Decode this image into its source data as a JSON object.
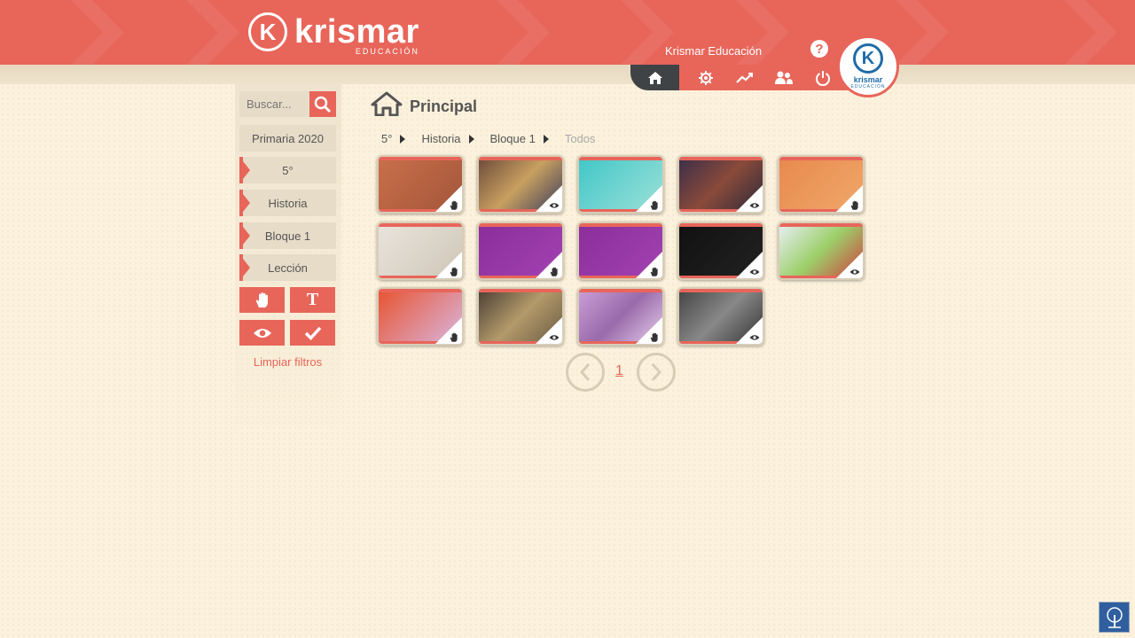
{
  "header": {
    "brand_word": "krismar",
    "brand_sub": "EDUCACIÓN",
    "user_name": "Krismar Educación",
    "help": "?",
    "avatar_word": "krismar",
    "avatar_sub": "EDUCACIÓN",
    "accent": "#e8655a",
    "dark": "#3f4345"
  },
  "nav": {
    "items": [
      "home-icon",
      "gear-icon",
      "chart-icon",
      "users-icon",
      "power-icon"
    ]
  },
  "sidebar": {
    "search_placeholder": "Buscar...",
    "filters": [
      "Primaria 2020",
      "5°",
      "Historia",
      "Bloque 1",
      "Lección"
    ],
    "tools": [
      "hand-icon",
      "T",
      "eye-icon",
      "check-icon"
    ],
    "clear": "Limpiar filtros"
  },
  "main": {
    "title": "Principal",
    "breadcrumb": [
      "5°",
      "Historia",
      "Bloque 1",
      "Todos"
    ],
    "cards": [
      {
        "mode": "hand",
        "bg": "linear-gradient(135deg,#c9704a,#a3553a)"
      },
      {
        "mode": "eye",
        "bg": "linear-gradient(135deg,#6b4a3a,#c8a060,#3a3a5a)"
      },
      {
        "mode": "hand",
        "bg": "linear-gradient(135deg,#3fc7c7,#9ee0d8)"
      },
      {
        "mode": "eye",
        "bg": "linear-gradient(135deg,#3a2e4a,#8a4a3a,#2a2a3a)"
      },
      {
        "mode": "hand",
        "bg": "linear-gradient(135deg,#e8894e,#f0a86a)"
      },
      {
        "mode": "hand",
        "bg": "linear-gradient(135deg,#e9e4dc,#cfc6b8)"
      },
      {
        "mode": "hand",
        "bg": "linear-gradient(135deg,#8a2e9a,#a342b3)"
      },
      {
        "mode": "hand",
        "bg": "linear-gradient(135deg,#8a2e9a,#a342b3)"
      },
      {
        "mode": "eye",
        "bg": "linear-gradient(135deg,#111,#222)"
      },
      {
        "mode": "eye",
        "bg": "linear-gradient(135deg,#e8f0f6,#9ccf6a,#d23c3c)"
      },
      {
        "mode": "hand",
        "bg": "linear-gradient(135deg,#e8532f,#d9b6e0)"
      },
      {
        "mode": "eye",
        "bg": "linear-gradient(135deg,#4a3e34,#b39a6a,#6a5a44)"
      },
      {
        "mode": "hand",
        "bg": "linear-gradient(135deg,#caa0d8,#9a6aaa,#e6d0ee)"
      },
      {
        "mode": "eye",
        "bg": "linear-gradient(135deg,#444,#888,#333)"
      }
    ],
    "page": "1"
  }
}
